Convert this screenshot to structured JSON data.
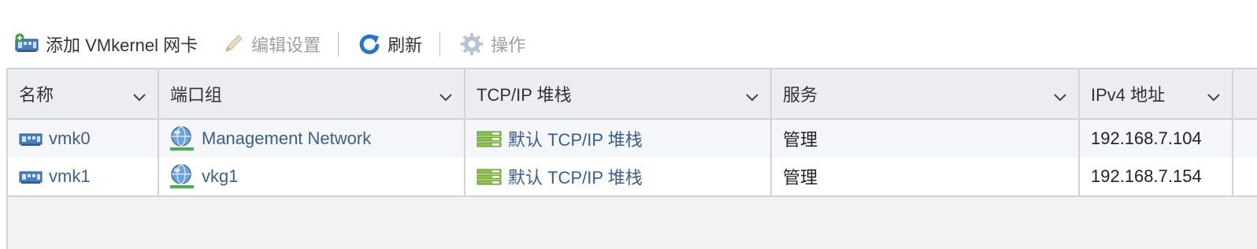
{
  "toolbar": {
    "add_vmkernel": {
      "label": "添加 VMkernel 网卡",
      "icon": "add-nic-icon"
    },
    "edit_settings": {
      "label": "编辑设置",
      "icon": "pencil-icon",
      "disabled": true
    },
    "refresh": {
      "label": "刷新",
      "icon": "refresh-icon"
    },
    "actions": {
      "label": "操作",
      "icon": "gear-icon",
      "disabled": true
    }
  },
  "table": {
    "columns": [
      "名称",
      "端口组",
      "TCP/IP 堆栈",
      "服务",
      "IPv4 地址"
    ],
    "rows": [
      {
        "name": "vmk0",
        "port_group": "Management Network",
        "tcpip_stack": "默认 TCP/IP 堆栈",
        "services": "管理",
        "ipv4": "192.168.7.104"
      },
      {
        "name": "vmk1",
        "port_group": "vkg1",
        "tcpip_stack": "默认 TCP/IP 堆栈",
        "services": "管理",
        "ipv4": "192.168.7.154"
      }
    ]
  },
  "colors": {
    "link": "#3a5f8f",
    "header_bg": "#ecedf0",
    "row_alt_bg": "#f4f6f9",
    "empty_bg": "#f2f2f2",
    "border": "#d4d4d4",
    "refresh_blue": "#2a74c9",
    "stack_green": "#7cb342"
  }
}
